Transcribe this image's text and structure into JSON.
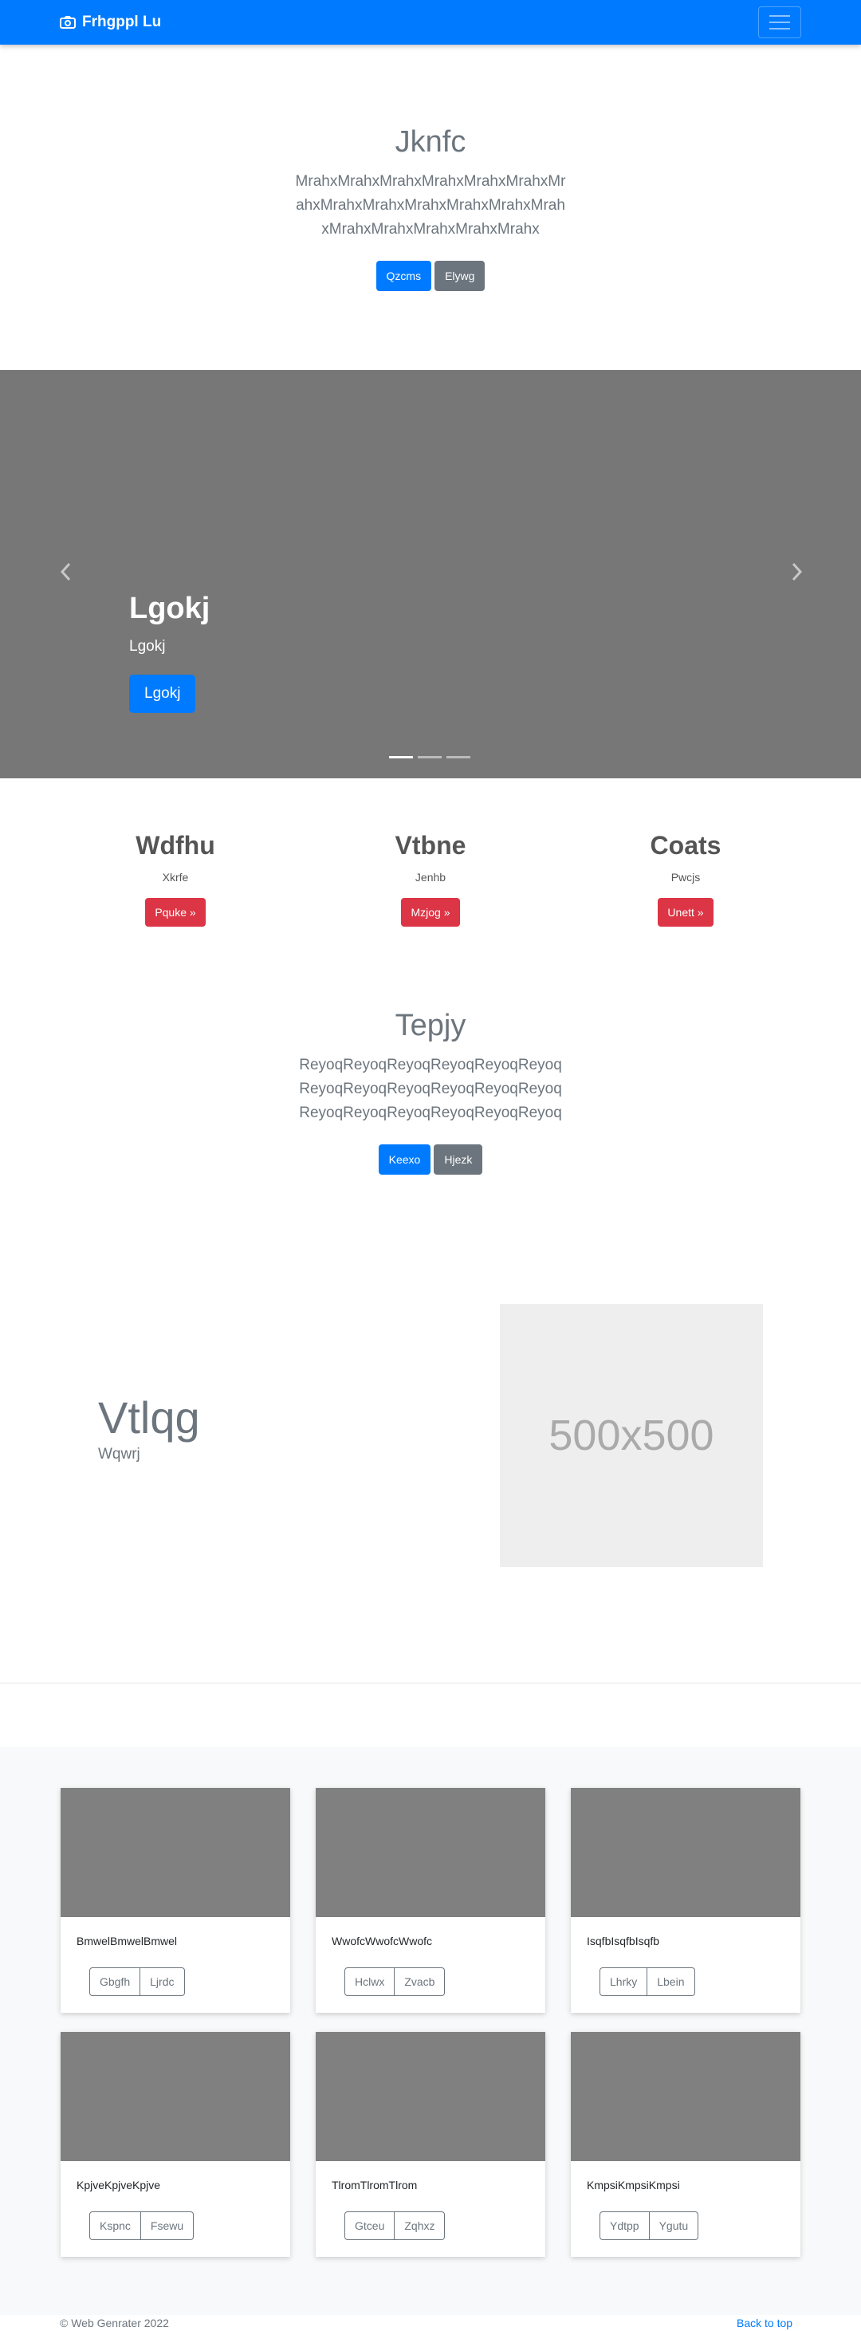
{
  "navbar": {
    "brand": "Frhgppl Lu",
    "brand_icon": "camera-icon",
    "toggler_icon": "hamburger-icon"
  },
  "hero": {
    "title": "Jknfc",
    "lead": "MrahxMrahxMrahxMrahxMrahxMrahxMrahxMrahxMrahxMrahxMrahxMrahxMrahxMrahxMrahxMrahxMrahxMrahx",
    "primary_button": "Qzcms",
    "secondary_button": "Elywg"
  },
  "carousel": {
    "title": "Lgokj",
    "text": "Lgokj",
    "button": "Lgokj",
    "slide_count": 3,
    "active_slide": 1
  },
  "features": [
    {
      "title": "Wdfhu",
      "text": "Xkrfe",
      "button": "Pquke »"
    },
    {
      "title": "Vtbne",
      "text": "Jenhb",
      "button": "Mzjog »"
    },
    {
      "title": "Coats",
      "text": "Pwcjs",
      "button": "Unett »"
    }
  ],
  "section2": {
    "title": "Tepjy",
    "lead": "ReyoqReyoqReyoqReyoqReyoqReyoqReyoqReyoqReyoqReyoqReyoqReyoqReyoqReyoqReyoqReyoqReyoqReyoq",
    "primary_button": "Keexo",
    "secondary_button": "Hjezk"
  },
  "featurette": {
    "heading": "Vtlqg",
    "subtext": "Wqwrj",
    "image_label": "500x500"
  },
  "cards": [
    {
      "text": "BmwelBmwelBmwel",
      "btn1": "Gbgfh",
      "btn2": "Ljrdc"
    },
    {
      "text": "WwofcWwofcWwofc",
      "btn1": "Hclwx",
      "btn2": "Zvacb"
    },
    {
      "text": "IsqfbIsqfbIsqfb",
      "btn1": "Lhrky",
      "btn2": "Lbein"
    },
    {
      "text": "KpjveKpjveKpjve",
      "btn1": "Kspnc",
      "btn2": "Fsewu"
    },
    {
      "text": "TlromTlromTlrom",
      "btn1": "Gtceu",
      "btn2": "Zqhxz"
    },
    {
      "text": "KmpsiKmpsiKmpsi",
      "btn1": "Ydtpp",
      "btn2": "Ygutu"
    }
  ],
  "footer": {
    "copyright": "© Web Genrater 2022",
    "back_to_top": "Back to top"
  },
  "colors": {
    "primary": "#007bff",
    "secondary": "#6c757d",
    "danger": "#dc3545",
    "carousel_bg": "#777777",
    "thumb_bg": "#808080"
  }
}
